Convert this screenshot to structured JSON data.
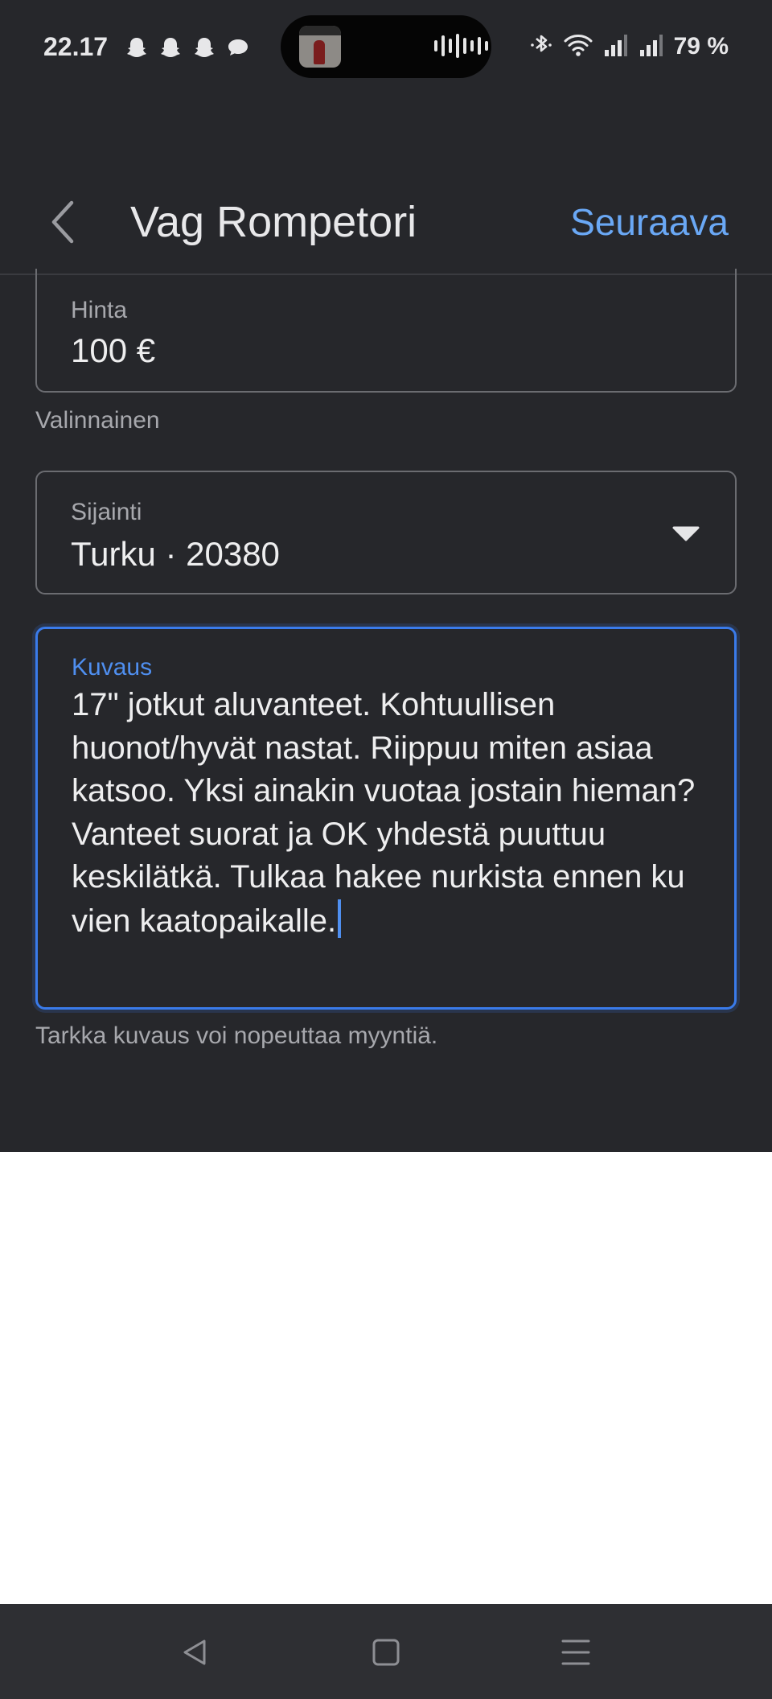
{
  "status_bar": {
    "time": "22.17",
    "battery": "79 %",
    "notification_icons": [
      "snapchat-icon",
      "snapchat-icon",
      "snapchat-icon",
      "chat-bubble-icon"
    ],
    "right_icons": [
      "bluetooth-icon",
      "wifi-icon",
      "signal-icon",
      "signal-icon"
    ]
  },
  "app_bar": {
    "title": "Vag Rompetori",
    "next_label": "Seuraava"
  },
  "form": {
    "price": {
      "label": "Hinta",
      "value": "100 €",
      "helper": "Valinnainen"
    },
    "location": {
      "label": "Sijainti",
      "value": "Turku · 20380"
    },
    "description": {
      "label": "Kuvaus",
      "value": "17\" jotkut aluvanteet. Kohtuullisen huonot/hyvät nastat. Riippuu miten asiaa katsoo. Yksi ainakin vuotaa jostain hieman? Vanteet suorat ja OK yhdestä puuttuu keskilätkä. Tulkaa hakee nurkista ennen ku vien kaatopaikalle.",
      "helper": "Tarkka kuvaus voi nopeuttaa myyntiä."
    }
  },
  "colors": {
    "background": "#26272b",
    "accent": "#6aa8f5",
    "focus": "#3a7bea"
  }
}
